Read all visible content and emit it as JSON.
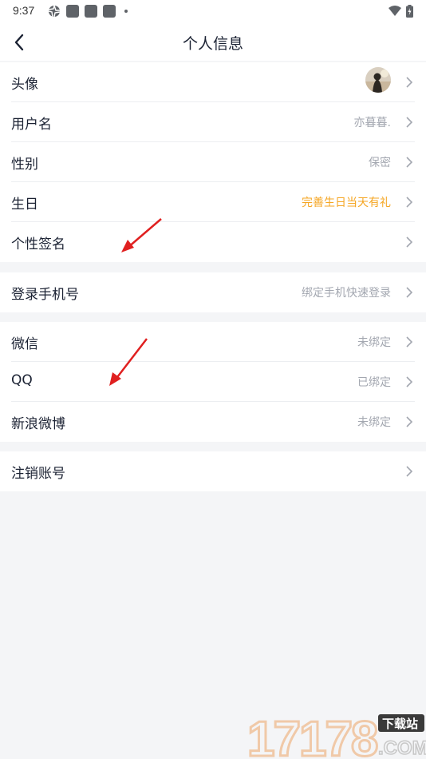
{
  "status_bar": {
    "time": "9:37"
  },
  "header": {
    "title": "个人信息"
  },
  "groups": [
    {
      "rows": [
        {
          "label": "头像",
          "value": ""
        },
        {
          "label": "用户名",
          "value": "亦暮暮."
        },
        {
          "label": "性别",
          "value": "保密"
        },
        {
          "label": "生日",
          "value": "完善生日当天有礼"
        },
        {
          "label": "个性签名",
          "value": ""
        }
      ]
    },
    {
      "rows": [
        {
          "label": "登录手机号",
          "value": "绑定手机快速登录"
        }
      ]
    },
    {
      "rows": [
        {
          "label": "微信",
          "value": "未绑定"
        },
        {
          "label": "QQ",
          "value": "已绑定"
        },
        {
          "label": "新浪微博",
          "value": "未绑定"
        }
      ]
    },
    {
      "rows": [
        {
          "label": "注销账号",
          "value": ""
        }
      ]
    }
  ],
  "colors": {
    "highlight": "#f5a623",
    "annotation_arrow": "#e02020"
  },
  "watermark": {
    "number": "17178",
    "tag": "下载站",
    "suffix": ".COM"
  }
}
